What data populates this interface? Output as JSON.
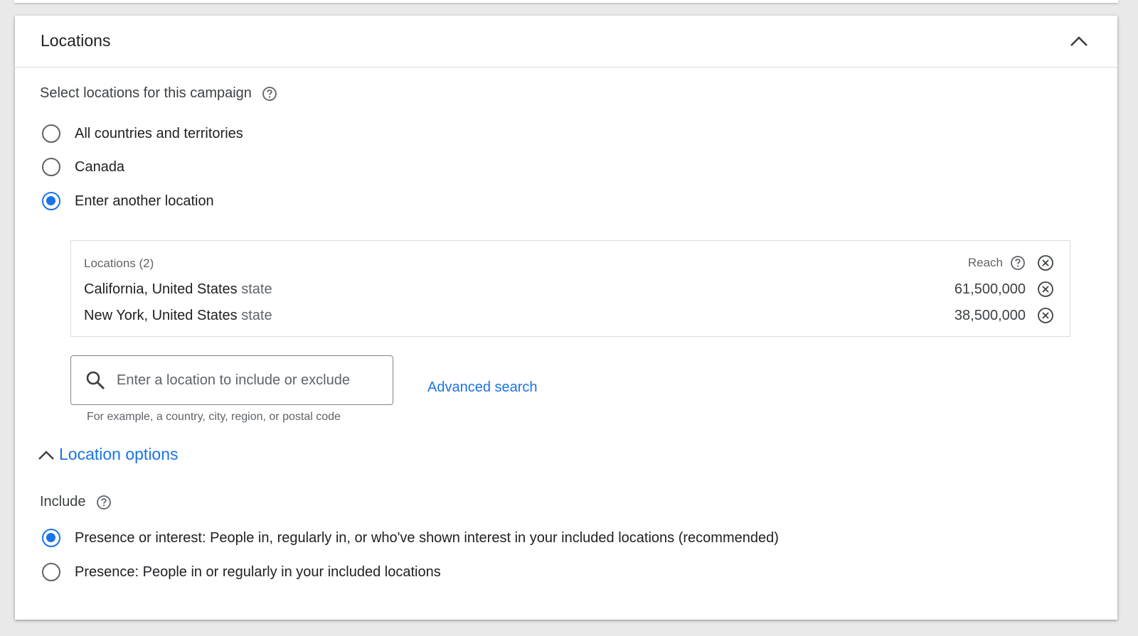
{
  "card": {
    "title": "Locations"
  },
  "select": {
    "label": "Select locations for this campaign",
    "options": [
      {
        "label": "All countries and territories",
        "checked": false
      },
      {
        "label": "Canada",
        "checked": false
      },
      {
        "label": "Enter another location",
        "checked": true
      }
    ]
  },
  "locations": {
    "header": "Locations (2)",
    "reach_label": "Reach",
    "rows": [
      {
        "name": "California, United States",
        "type": "state",
        "reach": "61,500,000"
      },
      {
        "name": "New York, United States",
        "type": "state",
        "reach": "38,500,000"
      }
    ]
  },
  "search": {
    "placeholder": "Enter a location to include or exclude",
    "helper": "For example, a country, city, region, or postal code",
    "advanced": "Advanced search"
  },
  "location_options": {
    "label": "Location options"
  },
  "include": {
    "label": "Include",
    "options": [
      {
        "label": "Presence or interest: People in, regularly in, or who've shown interest in your included locations (recommended)",
        "checked": true
      },
      {
        "label": "Presence: People in or regularly in your included locations",
        "checked": false
      }
    ]
  },
  "colors": {
    "accent": "#1a73e8",
    "text": "#202124",
    "secondary": "#5f6368",
    "border": "#dadce0"
  }
}
